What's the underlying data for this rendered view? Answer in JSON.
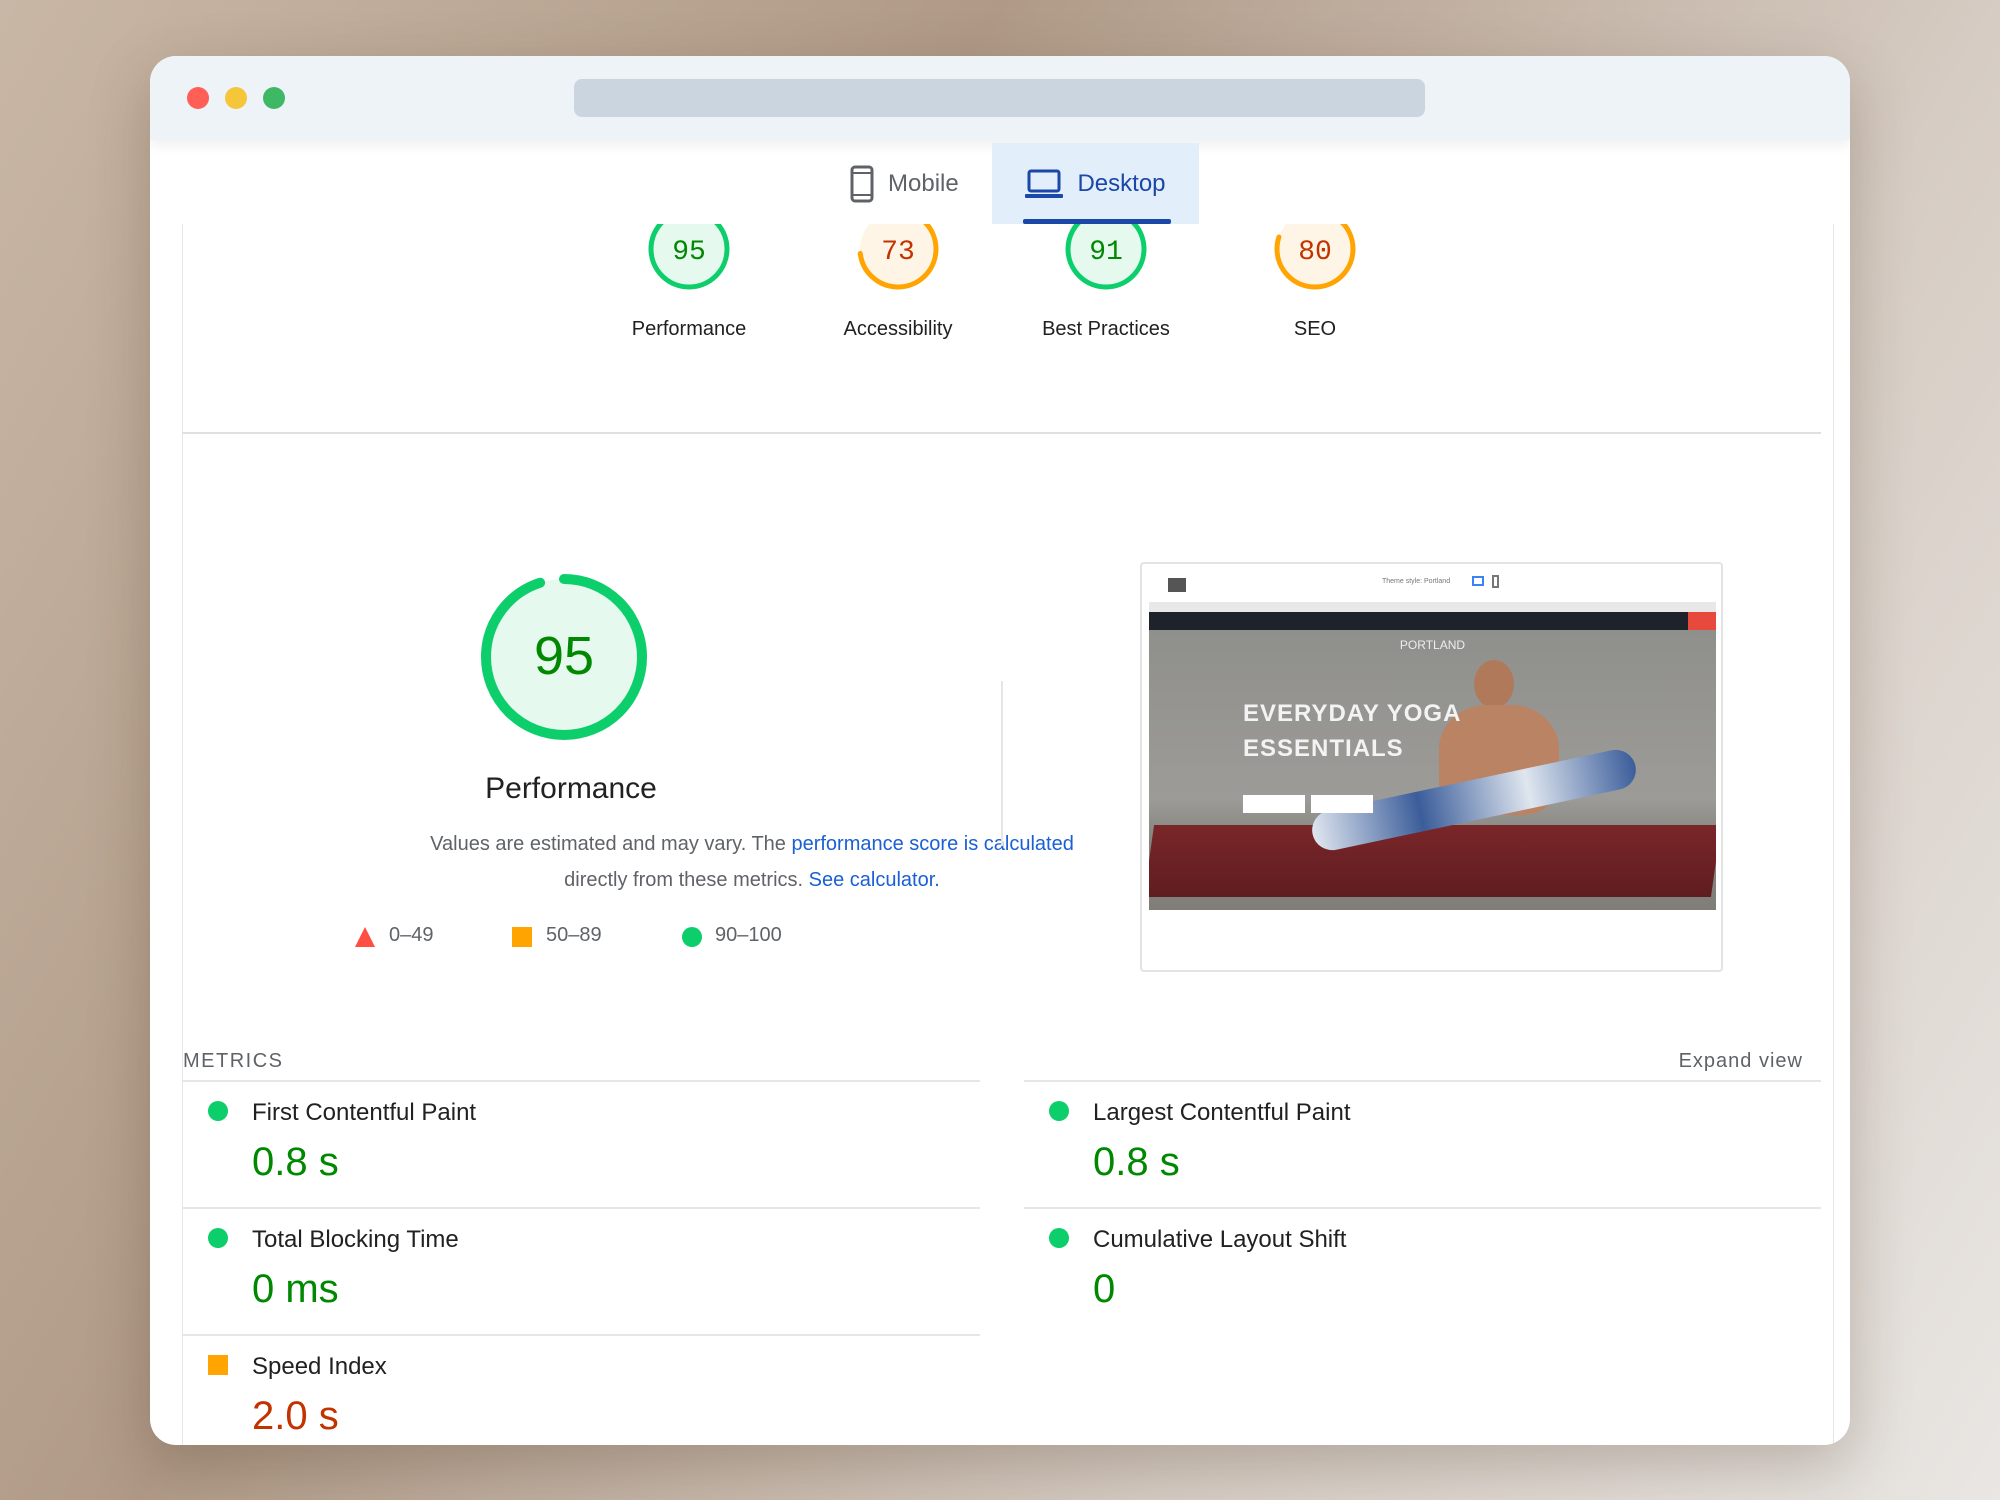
{
  "window": {
    "dots": [
      "#ff5f57",
      "#f5c53a",
      "#3fb866"
    ]
  },
  "tabs": [
    {
      "label": "Mobile",
      "icon": "phone-icon",
      "active": false
    },
    {
      "label": "Desktop",
      "icon": "laptop-icon",
      "active": true
    }
  ],
  "colors": {
    "good": "#0cce6b",
    "good_text": "#008800",
    "average": "#ffa400",
    "average_text": "#c33300",
    "poor": "#ff4e42",
    "link": "#1a5fd6",
    "tab_active": "#1a47a8"
  },
  "categories": [
    {
      "label": "Performance",
      "score": 95
    },
    {
      "label": "Accessibility",
      "score": 73
    },
    {
      "label": "Best Practices",
      "score": 91
    },
    {
      "label": "SEO",
      "score": 80
    }
  ],
  "performance": {
    "score": 95,
    "title": "Performance",
    "desc_pre": "Values are estimated and may vary. The ",
    "desc_link1": "performance score is calculated",
    "desc_mid": "directly from these metrics. ",
    "desc_link2": "See calculator.",
    "legend": [
      {
        "shape": "triangle",
        "range": "0–49"
      },
      {
        "shape": "square",
        "range": "50–89"
      },
      {
        "shape": "circle",
        "range": "90–100"
      }
    ]
  },
  "screenshot": {
    "headline1": "EVERYDAY YOGA",
    "headline2": "ESSENTIALS",
    "brand": "PORTLAND",
    "theme_style": "Theme style: Portland"
  },
  "metrics": {
    "header": "METRICS",
    "expand": "Expand view",
    "items": [
      {
        "label": "First Contentful Paint",
        "value": "0.8 s",
        "rating": "good"
      },
      {
        "label": "Largest Contentful Paint",
        "value": "0.8 s",
        "rating": "good"
      },
      {
        "label": "Total Blocking Time",
        "value": "0 ms",
        "rating": "good"
      },
      {
        "label": "Cumulative Layout Shift",
        "value": "0",
        "rating": "good"
      },
      {
        "label": "Speed Index",
        "value": "2.0 s",
        "rating": "average"
      }
    ]
  }
}
